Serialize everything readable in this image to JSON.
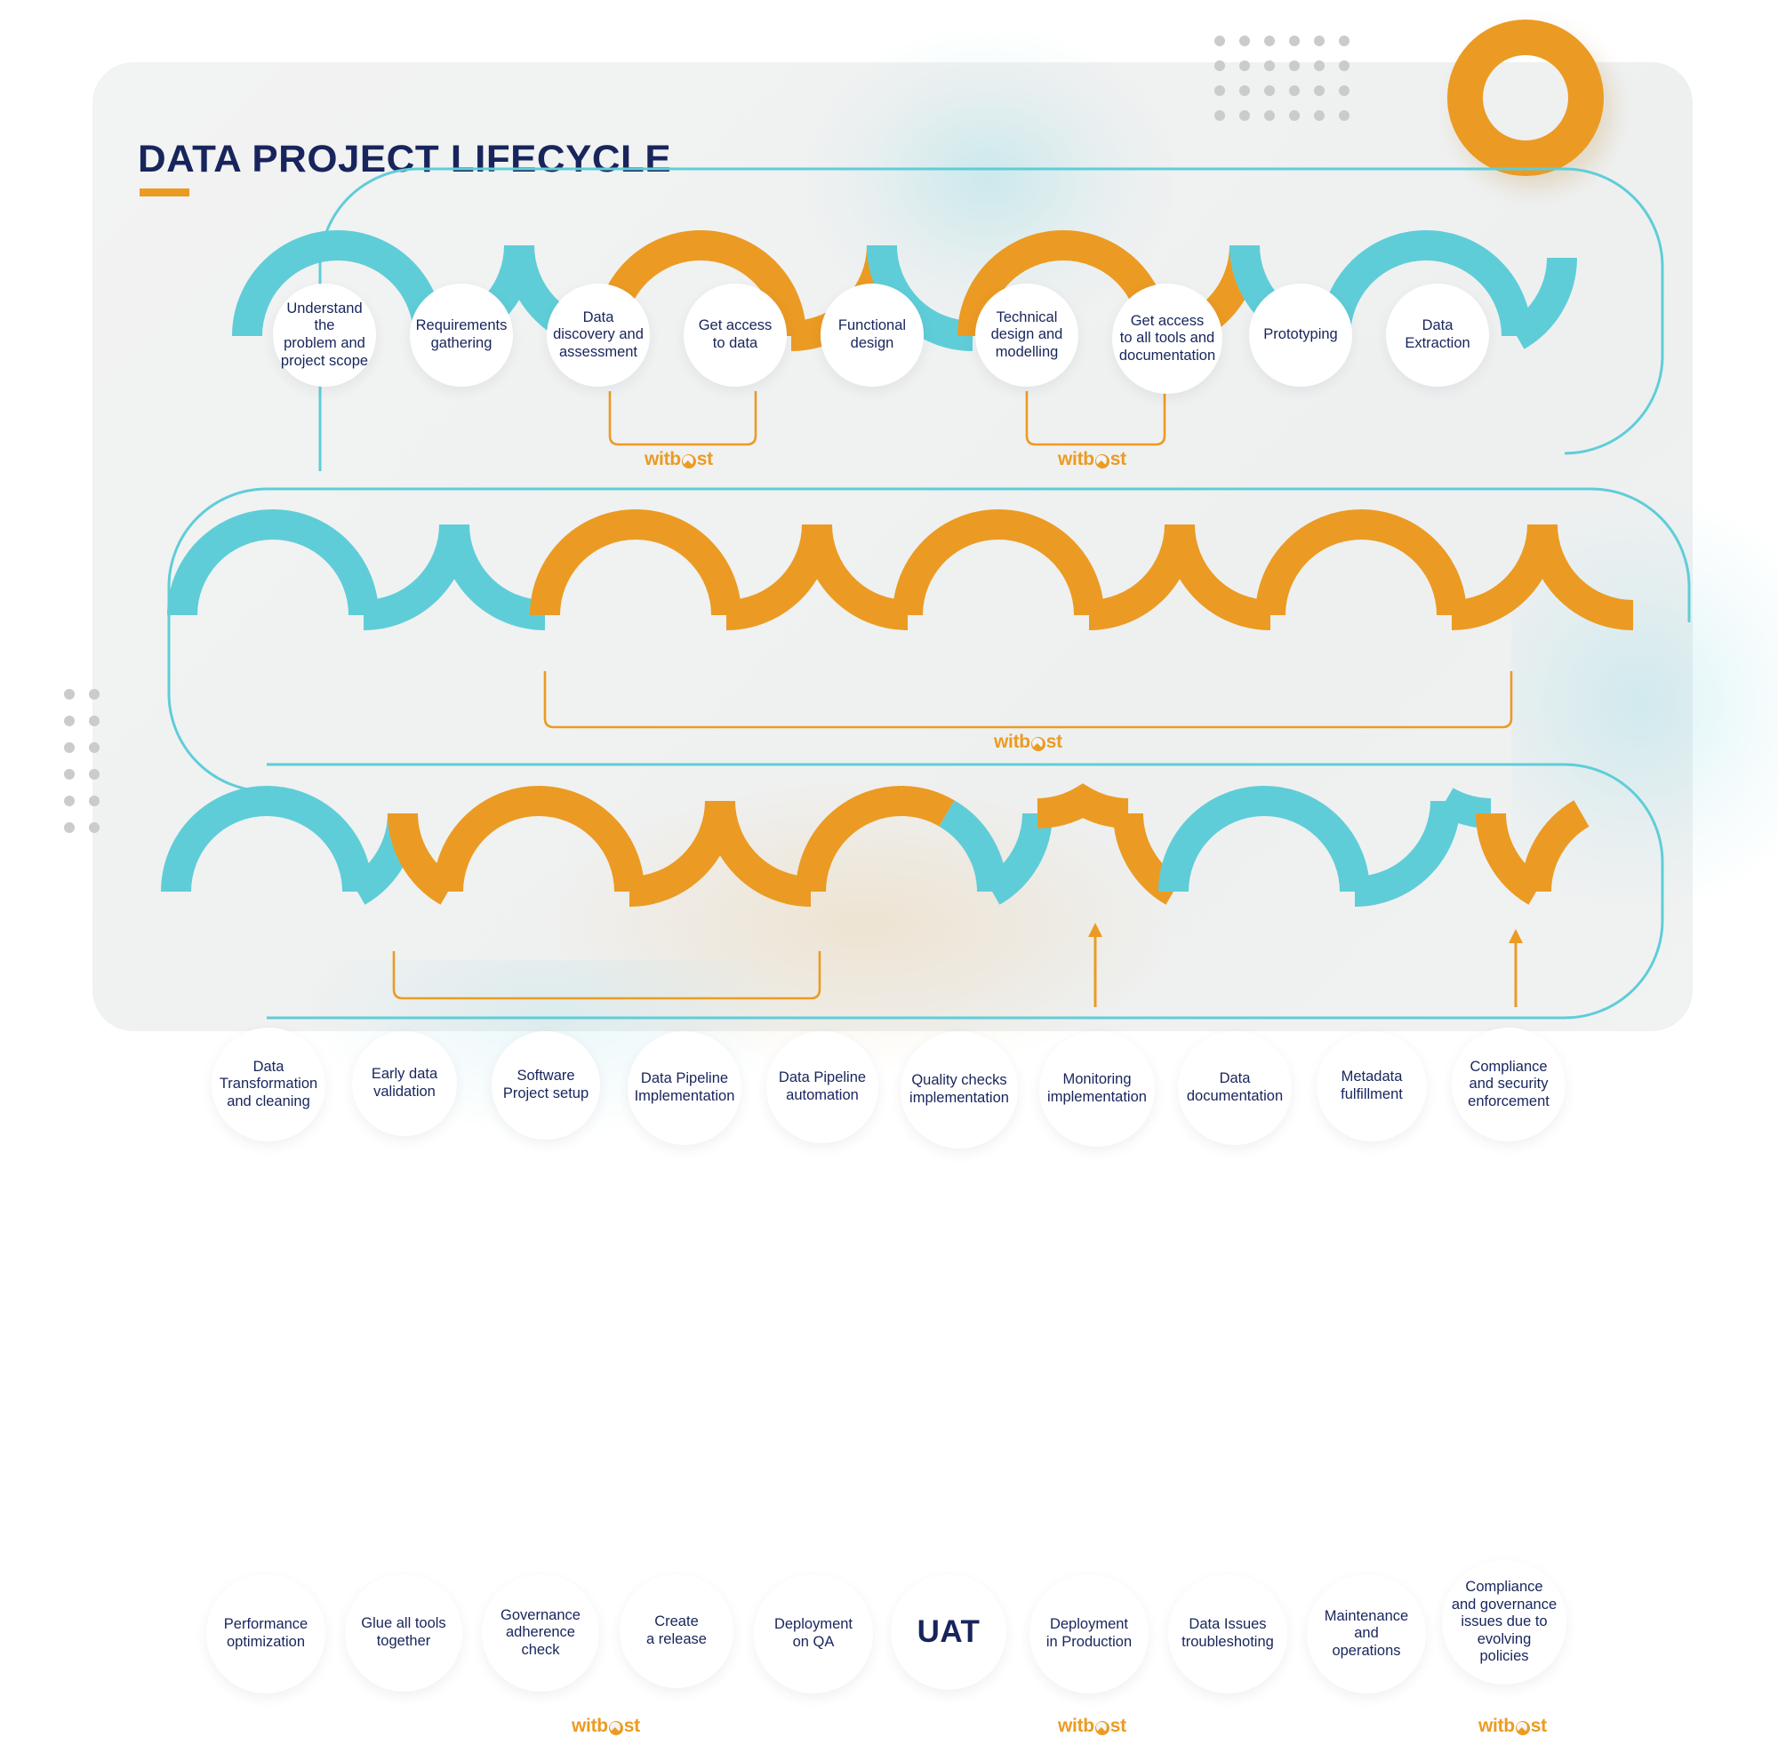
{
  "page": {
    "title": "DATA PROJECT LIFECYCLE",
    "brand_name": "witboost",
    "colors": {
      "navy": "#18255c",
      "orange": "#eb9b23",
      "teal": "#5fcdd8",
      "card_bg": "#f1f2f2",
      "node_bg": "#ffffff",
      "dot_grey": "#c9cbcd"
    }
  },
  "diagram_data": {
    "type": "process-flow",
    "title": "DATA PROJECT LIFECYCLE",
    "row_count": 3,
    "rows": [
      {
        "id": "row-1",
        "nodes": [
          {
            "label": "Understand the problem and project scope",
            "lines": [
              "Understand the",
              "problem and",
              "project scope"
            ]
          },
          {
            "label": "Requirements gathering",
            "lines": [
              "Requirements",
              "gathering"
            ]
          },
          {
            "label": "Data discovery and assessment",
            "lines": [
              "Data",
              "discovery and",
              "assessment"
            ]
          },
          {
            "label": "Get access to data",
            "lines": [
              "Get access",
              "to data"
            ]
          },
          {
            "label": "Functional design",
            "lines": [
              "Functional",
              "design"
            ]
          },
          {
            "label": "Technical design and modelling",
            "lines": [
              "Technical",
              "design and",
              "modelling"
            ]
          },
          {
            "label": "Get access to all tools and documentation",
            "lines": [
              "Get access",
              "to all tools and",
              "documentation"
            ]
          },
          {
            "label": "Prototyping",
            "lines": [
              "Prototyping"
            ]
          },
          {
            "label": "Data Extraction",
            "lines": [
              "Data",
              "Extraction"
            ]
          }
        ],
        "brackets": [
          {
            "label": "witboost",
            "from_node": 2,
            "to_node": 3
          },
          {
            "label": "witboost",
            "from_node": 5,
            "to_node": 6
          }
        ]
      },
      {
        "id": "row-2",
        "nodes": [
          {
            "label": "Data Transformation and cleaning",
            "lines": [
              "Data",
              "Transformation",
              "and cleaning"
            ]
          },
          {
            "label": "Early data validation",
            "lines": [
              "Early data",
              "validation"
            ]
          },
          {
            "label": "Software Project setup",
            "lines": [
              "Software",
              "Project setup"
            ]
          },
          {
            "label": "Data Pipeline Implementation",
            "lines": [
              "Data Pipeline",
              "Implementation"
            ]
          },
          {
            "label": "Data Pipeline automation",
            "lines": [
              "Data Pipeline",
              "automation"
            ]
          },
          {
            "label": "Quality checks implementation",
            "lines": [
              "Quality checks",
              "implementation"
            ]
          },
          {
            "label": "Monitoring implementation",
            "lines": [
              "Monitoring",
              "implementation"
            ]
          },
          {
            "label": "Data documentation",
            "lines": [
              "Data",
              "documentation"
            ]
          },
          {
            "label": "Metadata fulfillment",
            "lines": [
              "Metadata",
              "fulfillment"
            ]
          },
          {
            "label": "Compliance and security enforcement",
            "lines": [
              "Compliance",
              "and security",
              "enforcement"
            ]
          }
        ],
        "brackets": [
          {
            "label": "witboost",
            "from_node": 2,
            "to_node": 9
          }
        ]
      },
      {
        "id": "row-3",
        "nodes": [
          {
            "label": "Performance optimization",
            "lines": [
              "Performance",
              "optimization"
            ]
          },
          {
            "label": "Glue all tools together",
            "lines": [
              "Glue all tools",
              "together"
            ]
          },
          {
            "label": "Governance adherence check",
            "lines": [
              "Governance",
              "adherence",
              "check"
            ]
          },
          {
            "label": "Create a release",
            "lines": [
              "Create",
              "a release"
            ]
          },
          {
            "label": "Deployment on QA",
            "lines": [
              "Deployment",
              "on QA"
            ]
          },
          {
            "label": "UAT",
            "lines": [
              "UAT"
            ],
            "emphasis": true
          },
          {
            "label": "Deployment in Production",
            "lines": [
              "Deployment",
              "in Production"
            ]
          },
          {
            "label": "Data Issues troubleshoting",
            "lines": [
              "Data Issues",
              "troubleshoting"
            ]
          },
          {
            "label": "Maintenance and operations",
            "lines": [
              "Maintenance",
              "and",
              "operations"
            ]
          },
          {
            "label": "Compliance and governance issues due to evolving policies",
            "lines": [
              "Compliance",
              "and governance",
              "issues due to",
              "evolving",
              "policies"
            ]
          }
        ],
        "brackets": [
          {
            "label": "witboost",
            "from_node": 1,
            "to_node": 4
          }
        ],
        "arrows": [
          {
            "label": "witboost",
            "to_node": 6
          },
          {
            "label": "witboost",
            "to_node": 9
          }
        ]
      }
    ]
  }
}
